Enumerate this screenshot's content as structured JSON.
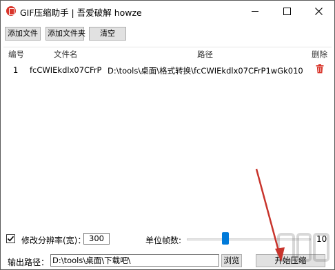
{
  "window": {
    "title": "GIF压缩助手 | 吾爱破解 howze",
    "controls": {
      "minimize": "minimize",
      "maximize": "maximize",
      "close": "close"
    }
  },
  "toolbar": {
    "add_file": "添加文件",
    "add_folder": "添加文件夹",
    "clear": "清空"
  },
  "file_list": {
    "columns": [
      "编号",
      "文件名",
      "路径",
      "删除"
    ],
    "rows": [
      {
        "no": "1",
        "name": "fcCWIEkdlx07CFrP",
        "path": "D:\\tools\\桌面\\格式转换\\fcCWIEkdlx07CFrP1wGk010",
        "delete_icon": "trash-icon"
      }
    ]
  },
  "options": {
    "resize_checked": true,
    "resize_label": "修改分辨率(宽)：",
    "width_value": "300",
    "fps_label": "单位帧数:",
    "fps_slider_level": 0.3,
    "fps_value": "10"
  },
  "output": {
    "label": "输出路径：",
    "path": "D:\\tools\\桌面\\下载吧\\",
    "browse": "浏览",
    "start": "开始压缩"
  },
  "colors": {
    "accent": "#007ad9",
    "icon_red": "#d9352b",
    "annotation_arrow": "#c8342c"
  }
}
